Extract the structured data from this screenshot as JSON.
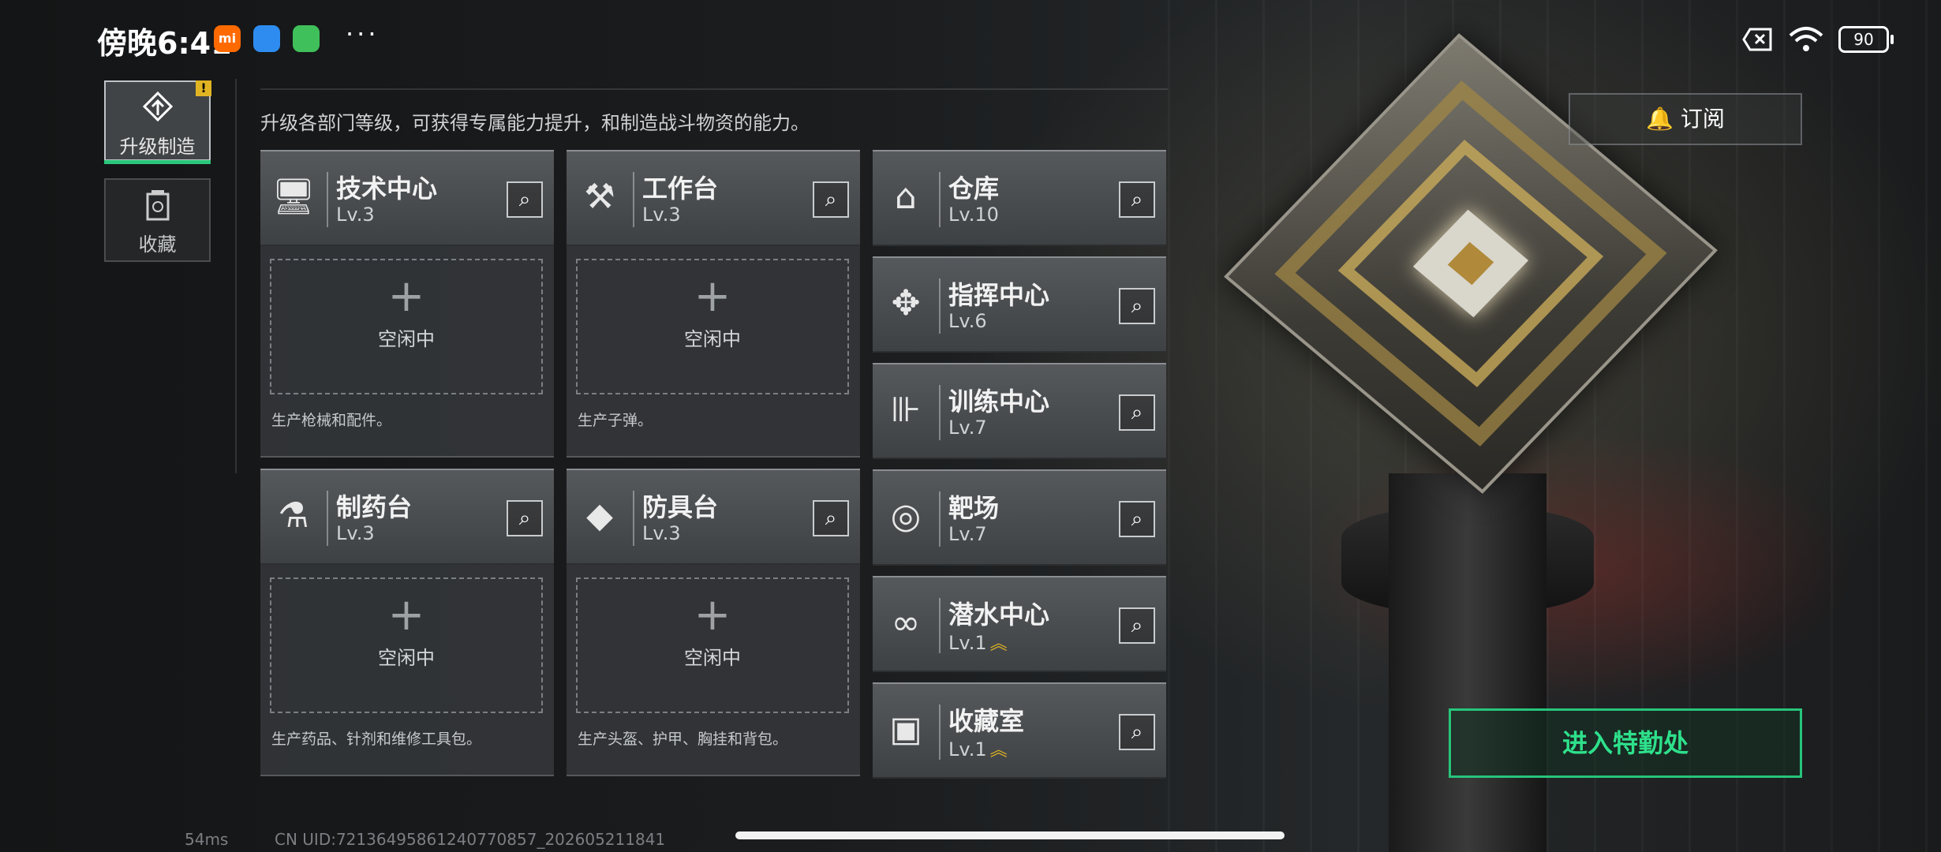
{
  "status_bar": {
    "time": "傍晚6:41",
    "apps": [
      {
        "name": "mi-app-icon",
        "label": "mi",
        "color": "#ff6a00"
      },
      {
        "name": "chat-app-icon",
        "label": "",
        "color": "#2e8cf0"
      },
      {
        "name": "tool-app-icon",
        "label": "",
        "color": "#3fc05a"
      }
    ],
    "more": "···",
    "battery": "90"
  },
  "sidebar": {
    "items": [
      {
        "label": "升级制造",
        "icon": "upgrade-icon",
        "active": true,
        "badge": "!"
      },
      {
        "label": "收藏",
        "icon": "collection-icon",
        "active": false
      }
    ]
  },
  "description": "升级各部门等级，可获得专属能力提升，和制造战斗物资的能力。",
  "workshops": [
    {
      "name": "技术中心",
      "level": "Lv.3",
      "icon": "tech-center-icon",
      "slot": "空闲中",
      "desc": "生产枪械和配件。"
    },
    {
      "name": "工作台",
      "level": "Lv.3",
      "icon": "workbench-icon",
      "slot": "空闲中",
      "desc": "生产子弹。"
    },
    {
      "name": "制药台",
      "level": "Lv.3",
      "icon": "pharmacy-icon",
      "slot": "空闲中",
      "desc": "生产药品、针剂和维修工具包。"
    },
    {
      "name": "防具台",
      "level": "Lv.3",
      "icon": "armor-bench-icon",
      "slot": "空闲中",
      "desc": "生产头盔、护甲、胸挂和背包。"
    }
  ],
  "facilities": [
    {
      "name": "仓库",
      "level": "Lv.10",
      "icon": "warehouse-icon",
      "upgradable": false
    },
    {
      "name": "指挥中心",
      "level": "Lv.6",
      "icon": "command-center-icon",
      "upgradable": false
    },
    {
      "name": "训练中心",
      "level": "Lv.7",
      "icon": "training-center-icon",
      "upgradable": false
    },
    {
      "name": "靶场",
      "level": "Lv.7",
      "icon": "shooting-range-icon",
      "upgradable": false
    },
    {
      "name": "潜水中心",
      "level": "Lv.1",
      "icon": "diving-center-icon",
      "upgradable": true
    },
    {
      "name": "收藏室",
      "level": "Lv.1",
      "icon": "collection-room-icon",
      "upgradable": true
    }
  ],
  "subscribe_label": "订阅",
  "enter_label": "进入特勤处",
  "footer": {
    "ping": "54ms",
    "uid": "CN UID:72136495861240770857_202605211841"
  },
  "colors": {
    "accent": "#2ac77a",
    "warning": "#e1b424"
  }
}
